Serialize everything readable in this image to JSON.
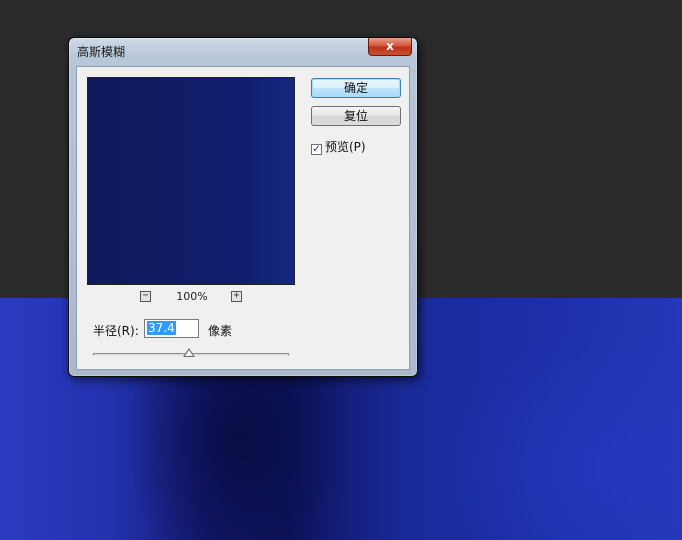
{
  "window": {
    "title": "高斯模糊",
    "close_glyph": "x"
  },
  "preview": {
    "zoom_out_glyph": "−",
    "zoom_in_glyph": "+",
    "zoom_level": "100%",
    "color": "#0f1c66"
  },
  "buttons": {
    "ok_label": "确定",
    "reset_label": "复位"
  },
  "preview_checkbox": {
    "label": "预览(P)",
    "checked": true,
    "check_glyph": "✓"
  },
  "radius": {
    "label": "半径(R):",
    "value": "37.4",
    "unit": "像素",
    "slider_fraction": 0.49
  },
  "colors": {
    "canvas_background": "#2b2b2b",
    "canvas_blue": "#1c2fa8",
    "ok_accent": "#3c7fb1"
  }
}
